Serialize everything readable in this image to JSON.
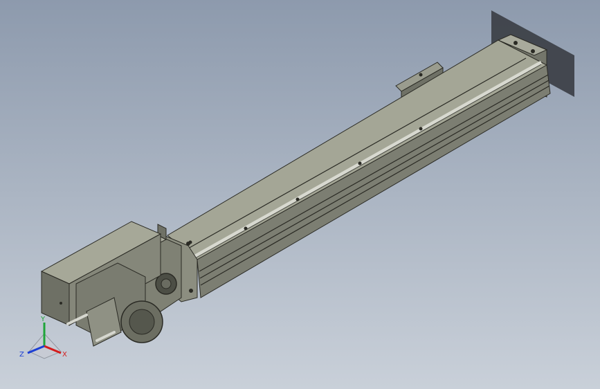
{
  "viewport": {
    "background_top": "#8d9aad",
    "background_bottom": "#c9d0d9",
    "model_body_color": "#8a8a7a",
    "model_edge_color": "#2a2a24"
  },
  "triad": {
    "x_label": "X",
    "y_label": "Y",
    "z_label": "Z",
    "x_color": "#d41c1c",
    "y_color": "#1fa53a",
    "z_color": "#1c3fd4"
  }
}
